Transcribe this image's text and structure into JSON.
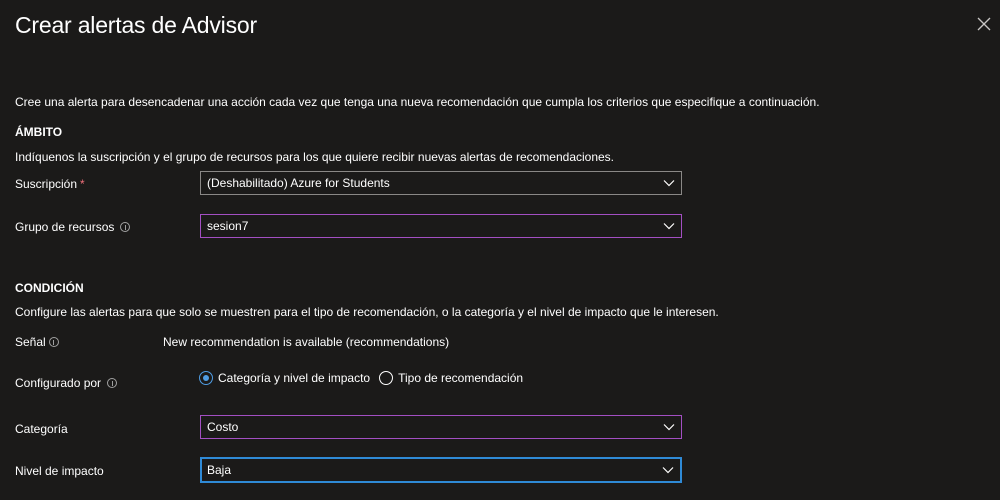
{
  "header": {
    "title": "Crear alertas de Advisor",
    "more_label": "···"
  },
  "intro": "Cree una alerta para desencadenar una acción cada vez que tenga una nueva recomendación que cumpla los criterios que especifique a continuación.",
  "scope": {
    "heading": "ÁMBITO",
    "description": "Indíquenos la suscripción y el grupo de recursos para los que quiere recibir nuevas alertas de recomendaciones.",
    "subscription": {
      "label": "Suscripción",
      "required_mark": "*",
      "value": "(Deshabilitado) Azure for Students"
    },
    "resource_group": {
      "label": "Grupo de recursos",
      "value": "sesion7"
    }
  },
  "condition": {
    "heading": "CONDICIÓN",
    "description": "Configure las alertas para que solo se muestren para el tipo de recomendación, o la categoría y el nivel de impacto que le interesen.",
    "signal": {
      "label": "Señal",
      "value": "New recommendation is available (recommendations)"
    },
    "configured_by": {
      "label": "Configurado por",
      "options": [
        {
          "label": "Categoría y nivel de impacto",
          "selected": true
        },
        {
          "label": "Tipo de recomendación",
          "selected": false
        }
      ]
    },
    "category": {
      "label": "Categoría",
      "value": "Costo"
    },
    "impact_level": {
      "label": "Nivel de impacto",
      "value": "Baja"
    }
  },
  "colors": {
    "background": "#1b1a19",
    "accent_blue": "#4f9de4",
    "focus_border": "#2f8ad6",
    "purple_border": "#a34fc2",
    "required": "#f1707b"
  }
}
